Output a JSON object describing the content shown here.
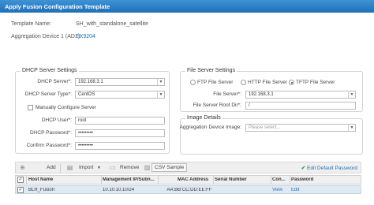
{
  "window": {
    "title": "Apply Fusion Configuration Template"
  },
  "info": {
    "template_label": "Template Name:",
    "template_value": "SH_with_standalone_satellite",
    "aggregation_label": "Aggregation Device 1 (AD1):",
    "aggregation_value": "EX9204"
  },
  "dhcp": {
    "legend": "DHCP Server Settings",
    "server_label": "DHCP Server*:",
    "server_value": "192.168.3.1",
    "type_label": "DHCP Server Type*:",
    "type_value": "CentOS",
    "manual_label": "Manually Configure Server",
    "user_label": "DHCP User*:",
    "user_value": "root",
    "password_label": "DHCP Password*:",
    "password_value": "•••••••••",
    "confirm_label": "Confirm Password*:",
    "confirm_value": "•••••••••"
  },
  "file_server": {
    "legend": "File Server Settings",
    "radio_ftp": "FTP File Server",
    "radio_http": "HTTP File Server",
    "radio_tftp": "TFTP File Server",
    "server_label": "File Server*:",
    "server_value": "192.168.3.1",
    "root_label": "File Server Root Dir*:",
    "root_value": "/"
  },
  "image": {
    "legend": "Image Details",
    "agg_image_label": "Aggregation Device Image:",
    "agg_image_placeholder": "Please select..."
  },
  "toolbar": {
    "add": "Add",
    "import": "Import",
    "remove": "Remove",
    "csv": "CSV Sample",
    "edit_default_password": "Edit Default Password"
  },
  "grid": {
    "headers": {
      "check": "✓",
      "host": "Host Name",
      "mgmt": "Management IP/Subn...",
      "mac": "MAC Address",
      "serial": "Serial Number",
      "con": "Con...",
      "password": "Password"
    },
    "rows": [
      {
        "check": "✓",
        "host": "BLR_Fusion",
        "mgmt": "10.10.10.10/24",
        "mac": "AA:BB:CC:DD:EE:FF",
        "serial": "",
        "con": "View",
        "password": "Edit"
      }
    ]
  },
  "colors": {
    "titlebar": "#1f6fb6",
    "link": "#1f6fb6",
    "selected_row": "#dfe9f4"
  }
}
